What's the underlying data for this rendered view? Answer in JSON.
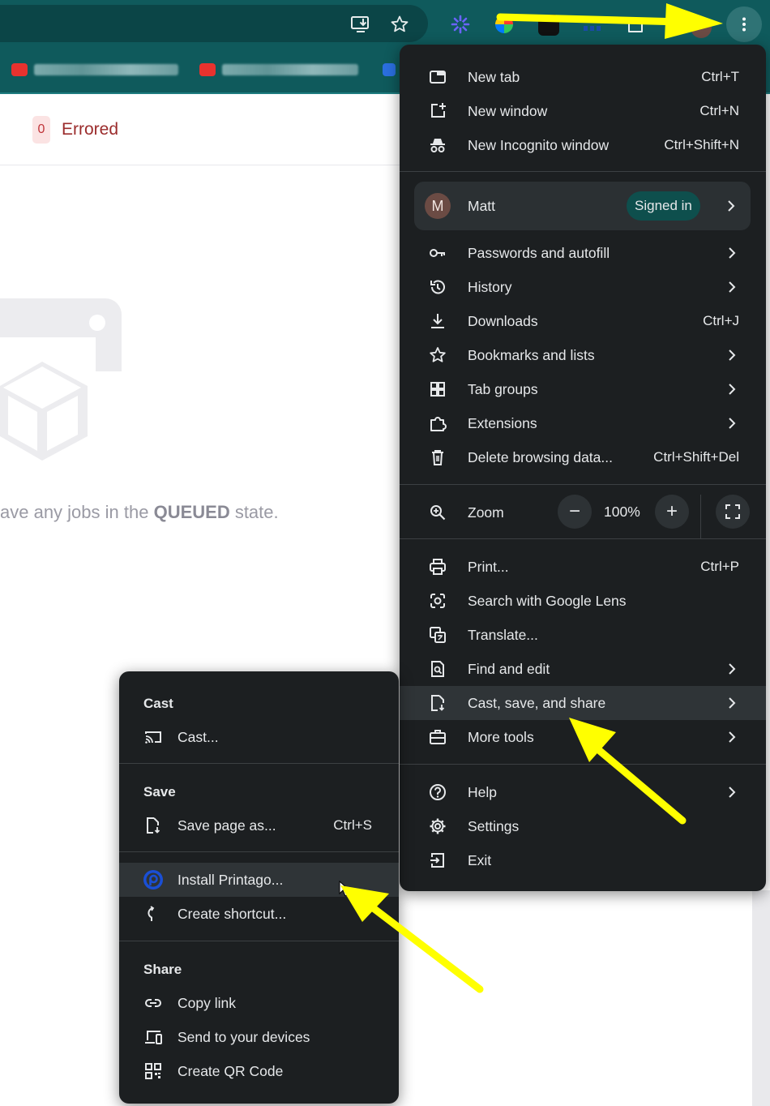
{
  "page": {
    "errored_count": "0",
    "errored_label": "Errored",
    "empty_prefix": "ave any jobs in the ",
    "empty_state": "QUEUED",
    "empty_suffix": " state."
  },
  "toolbar": {
    "icons": [
      "install-app-icon",
      "bookmark-star-icon",
      "extension-icons",
      "chrome-menu-icon"
    ],
    "colors": {
      "background": "#0f5a5c",
      "menu": "#1c1f21",
      "annotation_arrow": "#ffff00"
    }
  },
  "menu": {
    "new_tab": {
      "label": "New tab",
      "shortcut": "Ctrl+T"
    },
    "new_window": {
      "label": "New window",
      "shortcut": "Ctrl+N"
    },
    "incognito": {
      "label": "New Incognito window",
      "shortcut": "Ctrl+Shift+N"
    },
    "profile": {
      "initial": "M",
      "name": "Matt",
      "status": "Signed in"
    },
    "passwords": {
      "label": "Passwords and autofill"
    },
    "history": {
      "label": "History"
    },
    "downloads": {
      "label": "Downloads",
      "shortcut": "Ctrl+J"
    },
    "bookmarks": {
      "label": "Bookmarks and lists"
    },
    "tab_groups": {
      "label": "Tab groups"
    },
    "extensions": {
      "label": "Extensions"
    },
    "delete_data": {
      "label": "Delete browsing data...",
      "shortcut": "Ctrl+Shift+Del"
    },
    "zoom": {
      "label": "Zoom",
      "minus": "−",
      "value": "100%",
      "plus": "+"
    },
    "print": {
      "label": "Print...",
      "shortcut": "Ctrl+P"
    },
    "lens": {
      "label": "Search with Google Lens"
    },
    "translate": {
      "label": "Translate..."
    },
    "find": {
      "label": "Find and edit"
    },
    "cast_save_share": {
      "label": "Cast, save, and share"
    },
    "more_tools": {
      "label": "More tools"
    },
    "help": {
      "label": "Help"
    },
    "settings": {
      "label": "Settings"
    },
    "exit": {
      "label": "Exit"
    }
  },
  "submenu": {
    "cast_header": "Cast",
    "cast": {
      "label": "Cast..."
    },
    "save_header": "Save",
    "save_page": {
      "label": "Save page as...",
      "shortcut": "Ctrl+S"
    },
    "install": {
      "label": "Install Printago..."
    },
    "shortcut": {
      "label": "Create shortcut..."
    },
    "share_header": "Share",
    "copy_link": {
      "label": "Copy link"
    },
    "send_devices": {
      "label": "Send to your devices"
    },
    "qr": {
      "label": "Create QR Code"
    }
  }
}
